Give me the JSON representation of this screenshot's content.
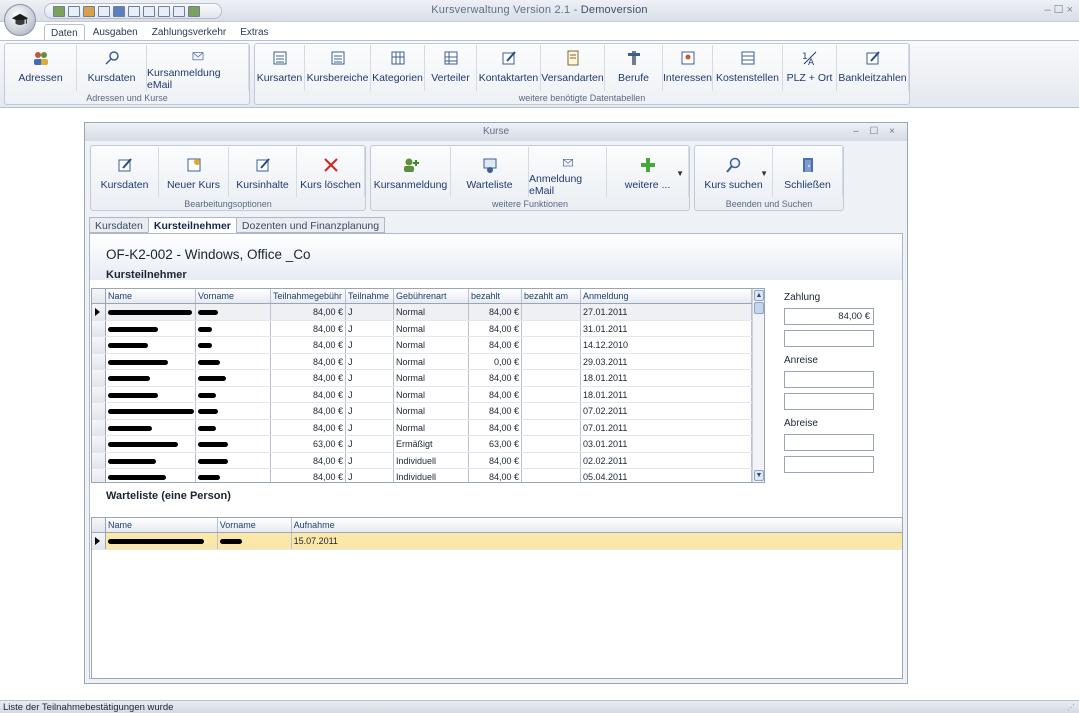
{
  "app": {
    "title": "Kursverwaltung Version 2.1 -",
    "title_suffix": "Demoversion",
    "window_controls": "– ☐ ×"
  },
  "ribbon_tabs": [
    {
      "label": "Daten",
      "active": true
    },
    {
      "label": "Ausgaben",
      "active": false
    },
    {
      "label": "Zahlungsverkehr",
      "active": false
    },
    {
      "label": "Extras",
      "active": false
    }
  ],
  "ribbon_groups": {
    "adressen_kurse": {
      "label": "Adressen und Kurse",
      "buttons": [
        {
          "label": "Adressen",
          "icon": "people-icon"
        },
        {
          "label": "Kursdaten",
          "icon": "key-icon"
        },
        {
          "label": "Kursanmeldung eMail",
          "icon": "envelope-icon"
        }
      ]
    },
    "weitere_tabellen": {
      "label": "weitere benötigte Datentabellen",
      "buttons": [
        {
          "label": "Kursarten",
          "icon": "table-icon"
        },
        {
          "label": "Kursbereiche",
          "icon": "table-icon"
        },
        {
          "label": "Kategorien",
          "icon": "grid-icon"
        },
        {
          "label": "Verteiler",
          "icon": "grid-icon"
        },
        {
          "label": "Kontaktarten",
          "icon": "edit-icon"
        },
        {
          "label": "Versandarten",
          "icon": "document-icon"
        },
        {
          "label": "Berufe",
          "icon": "tools-icon"
        },
        {
          "label": "Interessen",
          "icon": "card-icon"
        },
        {
          "label": "Kostenstellen",
          "icon": "table-icon"
        },
        {
          "label": "PLZ + Ort",
          "icon": "sort-icon"
        },
        {
          "label": "Bankleitzahlen",
          "icon": "edit-icon"
        }
      ]
    }
  },
  "kurse_window": {
    "title": "Kurse",
    "controls": "– ☐ ×",
    "groups": {
      "bearbeitung": {
        "label": "Bearbeitungsoptionen",
        "buttons": [
          {
            "label": "Kursdaten"
          },
          {
            "label": "Neuer Kurs"
          },
          {
            "label": "Kursinhalte"
          },
          {
            "label": "Kurs löschen"
          }
        ]
      },
      "funktionen": {
        "label": "weitere Funktionen",
        "buttons": [
          {
            "label": "Kursanmeldung"
          },
          {
            "label": "Warteliste"
          },
          {
            "label": "Anmeldung eMail"
          },
          {
            "label": "weitere ..."
          }
        ]
      },
      "beenden": {
        "label": "Beenden und Suchen",
        "buttons": [
          {
            "label": "Kurs suchen"
          },
          {
            "label": "Schließen"
          }
        ]
      }
    },
    "tabs": [
      {
        "label": "Kursdaten",
        "active": false
      },
      {
        "label": "Kursteilnehmer",
        "active": true
      },
      {
        "label": "Dozenten und Finanzplanung",
        "active": false
      }
    ],
    "course_title": "OF-K2-002 - Windows, Office _Co",
    "participants_heading": "Kursteilnehmer",
    "participants_columns": [
      "Name",
      "Vorname",
      "Teilnahmegebühr",
      "Teilnahme",
      "Gebührenart",
      "bezahlt",
      "bezahlt am",
      "Anmeldung"
    ],
    "participants": [
      {
        "gebuehr": "84,00 €",
        "teilnahme": "J",
        "art": "Normal",
        "bezahlt": "84,00 €",
        "bezahlt_am": "",
        "anmeldung": "27.01.2011"
      },
      {
        "gebuehr": "84,00 €",
        "teilnahme": "J",
        "art": "Normal",
        "bezahlt": "84,00 €",
        "bezahlt_am": "",
        "anmeldung": "31.01.2011"
      },
      {
        "gebuehr": "84,00 €",
        "teilnahme": "J",
        "art": "Normal",
        "bezahlt": "84,00 €",
        "bezahlt_am": "",
        "anmeldung": "14.12.2010"
      },
      {
        "gebuehr": "84,00 €",
        "teilnahme": "J",
        "art": "Normal",
        "bezahlt": "0,00 €",
        "bezahlt_am": "",
        "anmeldung": "29.03.2011"
      },
      {
        "gebuehr": "84,00 €",
        "teilnahme": "J",
        "art": "Normal",
        "bezahlt": "84,00 €",
        "bezahlt_am": "",
        "anmeldung": "18.01.2011"
      },
      {
        "gebuehr": "84,00 €",
        "teilnahme": "J",
        "art": "Normal",
        "bezahlt": "84,00 €",
        "bezahlt_am": "",
        "anmeldung": "18.01.2011"
      },
      {
        "gebuehr": "84,00 €",
        "teilnahme": "J",
        "art": "Normal",
        "bezahlt": "84,00 €",
        "bezahlt_am": "",
        "anmeldung": "07.02.2011"
      },
      {
        "gebuehr": "84,00 €",
        "teilnahme": "J",
        "art": "Normal",
        "bezahlt": "84,00 €",
        "bezahlt_am": "",
        "anmeldung": "07.01.2011"
      },
      {
        "gebuehr": "63,00 €",
        "teilnahme": "J",
        "art": "Ermäßigt",
        "bezahlt": "63,00 €",
        "bezahlt_am": "",
        "anmeldung": "03.01.2011"
      },
      {
        "gebuehr": "84,00 €",
        "teilnahme": "J",
        "art": "Individuell",
        "bezahlt": "84,00 €",
        "bezahlt_am": "",
        "anmeldung": "02.02.2011"
      },
      {
        "gebuehr": "84,00 €",
        "teilnahme": "J",
        "art": "Individuell",
        "bezahlt": "84,00 €",
        "bezahlt_am": "",
        "anmeldung": "05.04.2011"
      }
    ],
    "side_panel": {
      "zahlung_label": "Zahlung",
      "zahlung_value": "84,00 €",
      "anreise_label": "Anreise",
      "abreise_label": "Abreise"
    },
    "waitlist_heading": "Warteliste (eine Person)",
    "waitlist_columns": [
      "Name",
      "Vorname",
      "Aufnahme"
    ],
    "waitlist": [
      {
        "aufnahme": "15.07.2011"
      }
    ]
  },
  "status_bar": {
    "text": "Liste der Teilnahmebestätigungen wurde"
  },
  "colors": {
    "accent": "#1f3a6e",
    "selection_highlight": "#fbe7a8"
  }
}
